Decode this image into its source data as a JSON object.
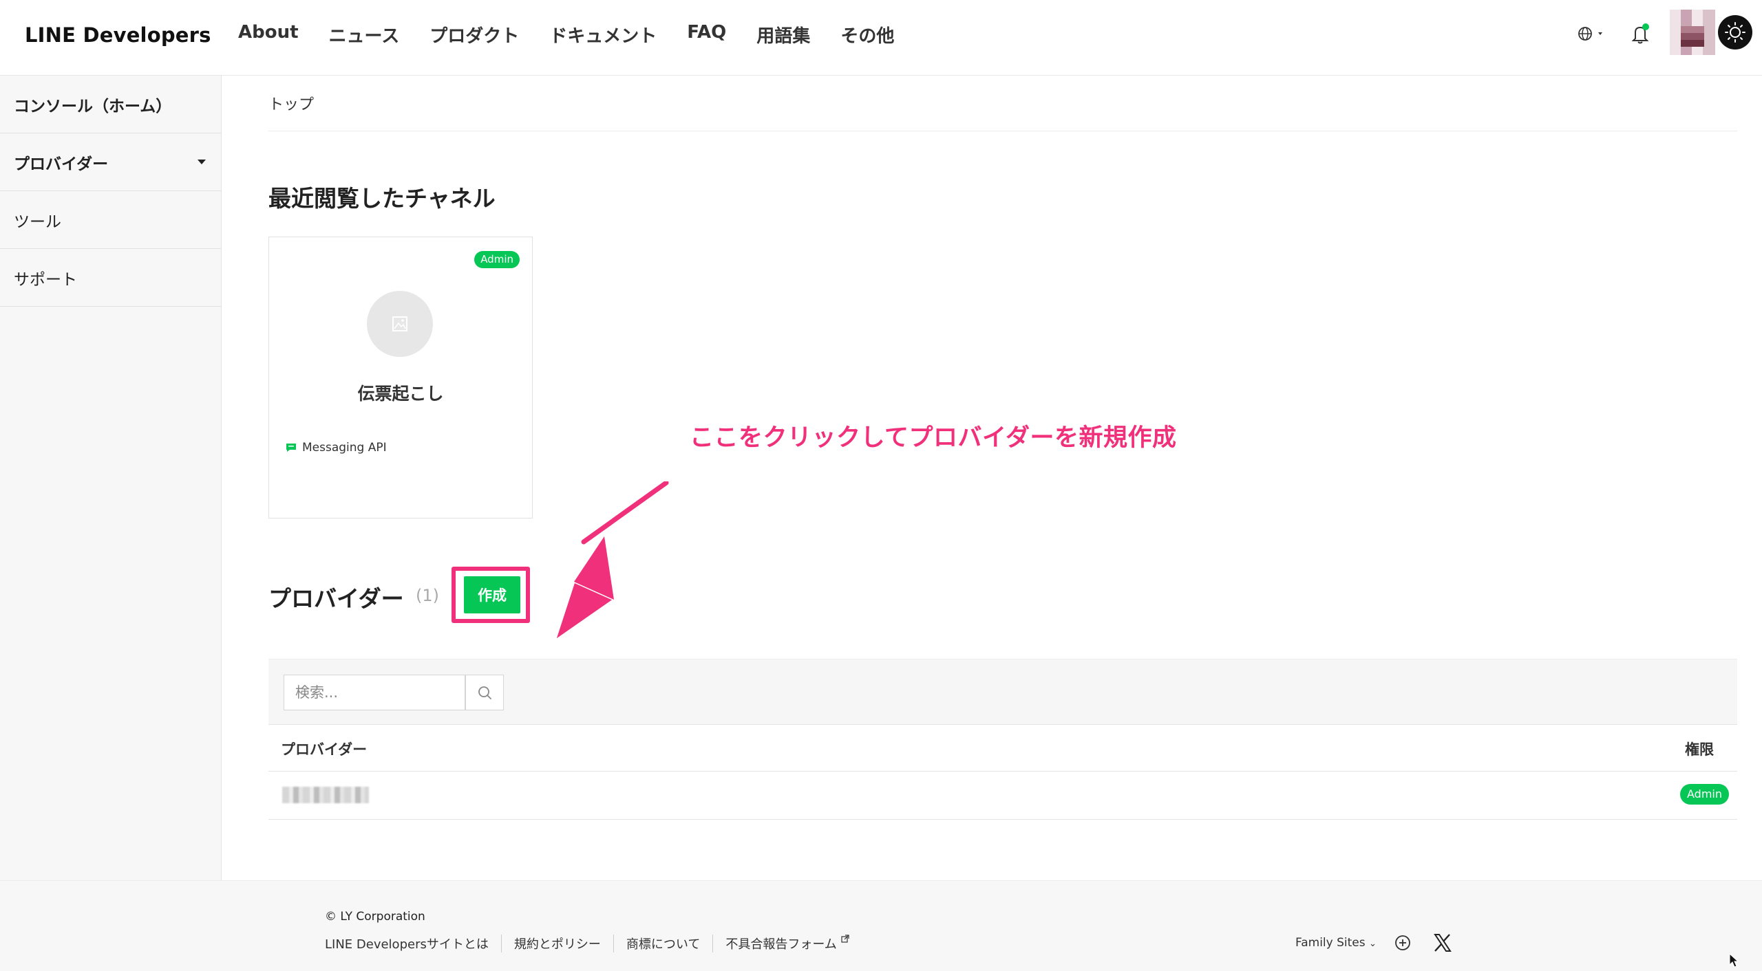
{
  "header": {
    "logo": "LINE Developers",
    "nav": [
      "About",
      "ニュース",
      "プロダクト",
      "ドキュメント",
      "FAQ",
      "用語集",
      "その他"
    ]
  },
  "sidebar": {
    "items": [
      {
        "label": "コンソール（ホーム）"
      },
      {
        "label": "プロバイダー"
      },
      {
        "label": "ツール"
      },
      {
        "label": "サポート"
      }
    ]
  },
  "main": {
    "breadcrumb": "トップ",
    "recent_title": "最近閲覧したチャネル",
    "channel_card": {
      "badge": "Admin",
      "name": "伝票起こし",
      "type": "Messaging API"
    },
    "annotation": "ここをクリックしてプロバイダーを新規作成",
    "provider_title": "プロバイダー",
    "provider_count": "(1)",
    "create_label": "作成",
    "search": {
      "placeholder": "検索..."
    },
    "table": {
      "col_provider": "プロバイダー",
      "col_permission": "権限",
      "rows": [
        {
          "permission": "Admin"
        }
      ]
    }
  },
  "footer": {
    "copyright": "© LY Corporation",
    "links": [
      "LINE Developersサイトとは",
      "規約とポリシー",
      "商標について",
      "不具合報告フォーム"
    ],
    "family_sites": "Family Sites"
  },
  "colors": {
    "accent": "#06c755",
    "annotation": "#f0307a"
  }
}
